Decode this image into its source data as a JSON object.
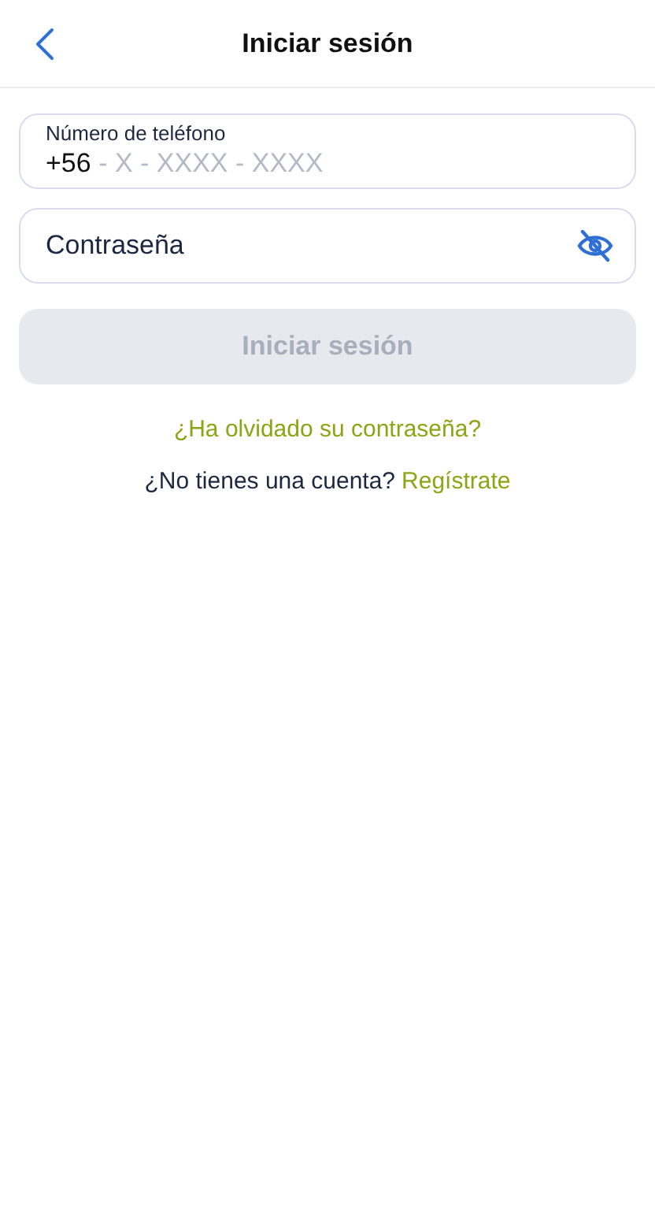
{
  "header": {
    "title": "Iniciar sesión"
  },
  "phone_field": {
    "label": "Número de teléfono",
    "prefix": "+56",
    "placeholder": " - X - XXXX - XXXX"
  },
  "password_field": {
    "placeholder": "Contraseña",
    "visible": false
  },
  "login_button": {
    "label": "Iniciar sesión",
    "disabled": true
  },
  "forgot_link": "¿Ha olvidado su contraseña?",
  "signup": {
    "text": "¿No tienes una cuenta?",
    "link": "Regístrate"
  }
}
